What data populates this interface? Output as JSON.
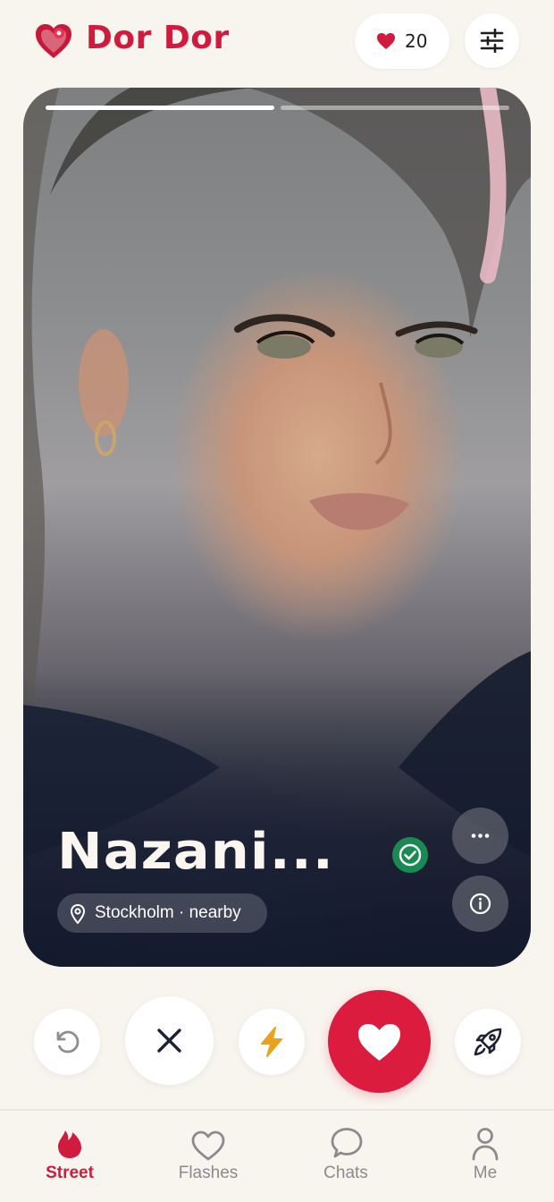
{
  "app": {
    "name": "Dor Dor",
    "brand_color": "#d01b3f"
  },
  "header": {
    "likes_count": "20"
  },
  "card": {
    "photo_progress": {
      "total": 2,
      "current": 1
    },
    "name": "Nazani...",
    "location": "Stockholm · nearby",
    "verified": true
  },
  "actions": [
    "rewind-icon",
    "close-icon",
    "lightning-icon",
    "heart-icon",
    "rocket-icon"
  ],
  "tabs": [
    {
      "label": "Street",
      "icon": "flame-icon",
      "active": true
    },
    {
      "label": "Flashes",
      "icon": "heart-outline-icon",
      "active": false
    },
    {
      "label": "Chats",
      "icon": "chat-bubble-icon",
      "active": false
    },
    {
      "label": "Me",
      "icon": "person-icon",
      "active": false
    }
  ]
}
